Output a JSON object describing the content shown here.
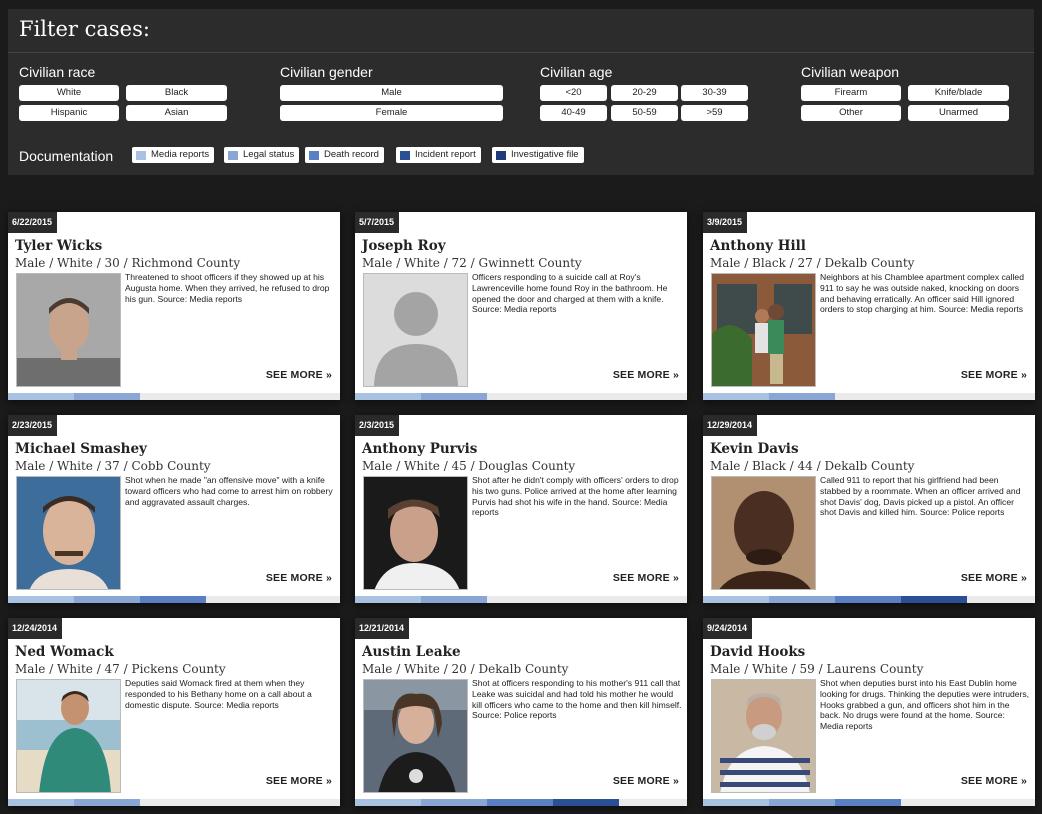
{
  "filter": {
    "title": "Filter cases:",
    "race": {
      "label": "Civilian race",
      "options": [
        "White",
        "Black",
        "Hispanic",
        "Asian"
      ]
    },
    "gender": {
      "label": "Civilian gender",
      "options": [
        "Male",
        "Female"
      ]
    },
    "age": {
      "label": "Civilian age",
      "options": [
        "<20",
        "20-29",
        "30-39",
        "40-49",
        "50-59",
        ">59"
      ]
    },
    "weapon": {
      "label": "Civilian weapon",
      "options": [
        "Firearm",
        "Knife/blade",
        "Other",
        "Unarmed"
      ]
    },
    "documentation": {
      "label": "Documentation",
      "items": [
        {
          "label": "Media reports",
          "color": "#a9c2e2"
        },
        {
          "label": "Legal status",
          "color": "#8aa6d4"
        },
        {
          "label": "Death record",
          "color": "#5b7fc3"
        },
        {
          "label": "Incident report",
          "color": "#2a4f94"
        },
        {
          "label": "Investigative file",
          "color": "#1f3b7a"
        }
      ]
    }
  },
  "see_more_label": "SEE MORE »",
  "cases": [
    {
      "date": "6/22/2015",
      "name": "Tyler Wicks",
      "meta": "Male / White / 30 / Richmond County",
      "description": "Threatened to shoot officers if they showed up at his Augusta home. When they arrived, he refused to drop his gun. Source: Media reports",
      "photo": "mugshot",
      "docs": 2
    },
    {
      "date": "5/7/2015",
      "name": "Joseph Roy",
      "meta": "Male / White / 72 / Gwinnett County",
      "description": "Officers responding to a suicide call at Roy's Lawrenceville home found Roy in the bathroom. He opened the door and charged at them with a knife. Source: Media reports",
      "photo": "placeholder",
      "docs": 2
    },
    {
      "date": "3/9/2015",
      "name": "Anthony Hill",
      "meta": "Male / Black / 27 / Dekalb County",
      "description": "Neighbors at his Chamblee apartment complex called 911 to say he was outside naked, knocking on doors and behaving erratically. An officer said Hill ignored orders to stop charging at him. Source: Media reports",
      "photo": "couple",
      "docs": 2
    },
    {
      "date": "2/23/2015",
      "name": "Michael Smashey",
      "meta": "Male / White / 37 / Cobb County",
      "description": "Shot when he made \"an offensive move\" with a knife toward officers who had come to arrest him on robbery and aggravated assault charges.",
      "photo": "mugshot-blue",
      "docs": 3
    },
    {
      "date": "2/3/2015",
      "name": "Anthony Purvis",
      "meta": "Male / White / 45 / Douglas County",
      "description": "Shot after he didn't comply with officers' orders to drop his two guns. Police arrived at the home after learning Purvis had shot his wife in the hand. Source: Media reports",
      "photo": "dark",
      "docs": 2
    },
    {
      "date": "12/29/2014",
      "name": "Kevin Davis",
      "meta": "Male / Black / 44 / Dekalb County",
      "description": "Called 911 to report that his girlfriend had been stabbed by a roommate. When an officer arrived and shot Davis' dog, Davis picked up a pistol. An officer shot Davis and killed him. Source: Police reports",
      "photo": "portrait-dark",
      "docs": 4
    },
    {
      "date": "12/24/2014",
      "name": "Ned Womack",
      "meta": "Male / White / 47 / Pickens County",
      "description": "Deputies said Womack fired at them when they responded to his Bethany home on a call about a domestic dispute. Source: Media reports",
      "photo": "beach",
      "docs": 2
    },
    {
      "date": "12/21/2014",
      "name": "Austin Leake",
      "meta": "Male / White / 20 / Dekalb County",
      "description": "Shot at officers responding to his mother's 911 call that Leake was suicidal and had told his mother he would kill officers who came to the home and then kill himself. Source: Police reports",
      "photo": "car",
      "docs": 4
    },
    {
      "date": "9/24/2014",
      "name": "David Hooks",
      "meta": "Male / White / 59 / Laurens County",
      "description": "Shot when deputies burst into his East Dublin home looking for drugs. Thinking the deputies were intruders, Hooks grabbed a gun, and officers shot him in the back. No drugs were found at the home. Source: Media reports",
      "photo": "striped",
      "docs": 3
    }
  ]
}
